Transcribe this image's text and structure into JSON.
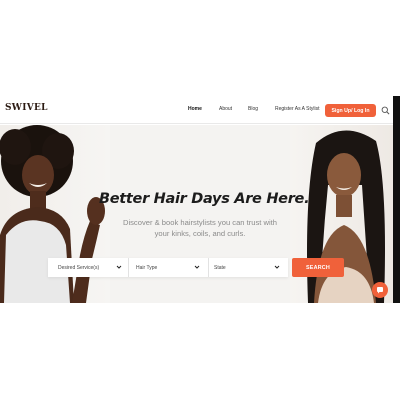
{
  "brand": {
    "logo": "SWIVEL"
  },
  "nav": {
    "links": [
      "Home",
      "About",
      "Blog",
      "Register As A Stylist"
    ],
    "signup_label": "Sign Up/ Log In",
    "search_icon": "search-icon"
  },
  "hero": {
    "headline": "Better Hair Days Are Here.",
    "subheadline_line1": "Discover & book hairstylists you can trust with",
    "subheadline_line2": "your kinks, coils, and curls."
  },
  "search": {
    "fields": [
      "Desired Service(s)",
      "Hair Type",
      "State"
    ],
    "button_label": "SEARCH"
  },
  "colors": {
    "accent": "#f0613a",
    "text": "#1c1c1c",
    "muted": "#8b8b8b"
  },
  "chat": {
    "icon": "chat-icon"
  }
}
